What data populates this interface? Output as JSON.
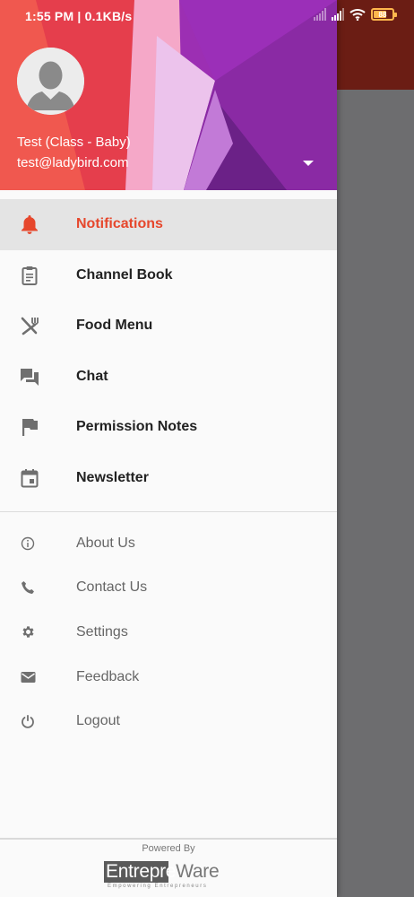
{
  "status_bar": {
    "time_speed": "1:55 PM | 0.1KB/s",
    "battery_level": "88"
  },
  "header": {
    "user_name": "Test (Class - Baby)",
    "user_email": "test@ladybird.com",
    "colors": {
      "primary": "#9c27b0",
      "accent_red": "#ef4444"
    }
  },
  "menu": {
    "primary_items": [
      {
        "label": "Notifications",
        "icon": "bell-icon",
        "active": true
      },
      {
        "label": "Channel Book",
        "icon": "clipboard-icon"
      },
      {
        "label": "Food Menu",
        "icon": "fork-knife-icon"
      },
      {
        "label": "Chat",
        "icon": "chat-icon"
      },
      {
        "label": "Permission Notes",
        "icon": "flag-icon"
      },
      {
        "label": "Newsletter",
        "icon": "calendar-icon"
      }
    ],
    "secondary_items": [
      {
        "label": "About Us",
        "icon": "info-icon"
      },
      {
        "label": "Contact Us",
        "icon": "phone-icon"
      },
      {
        "label": "Settings",
        "icon": "gear-icon"
      },
      {
        "label": "Feedback",
        "icon": "mail-icon"
      },
      {
        "label": "Logout",
        "icon": "power-icon"
      }
    ],
    "active_color": "#e6472c"
  },
  "footer": {
    "powered_by": "Powered By",
    "brand_part1": "Entrepre",
    "brand_part2": "Ware",
    "brand_tagline": "Empowering Entrepreneurs"
  }
}
